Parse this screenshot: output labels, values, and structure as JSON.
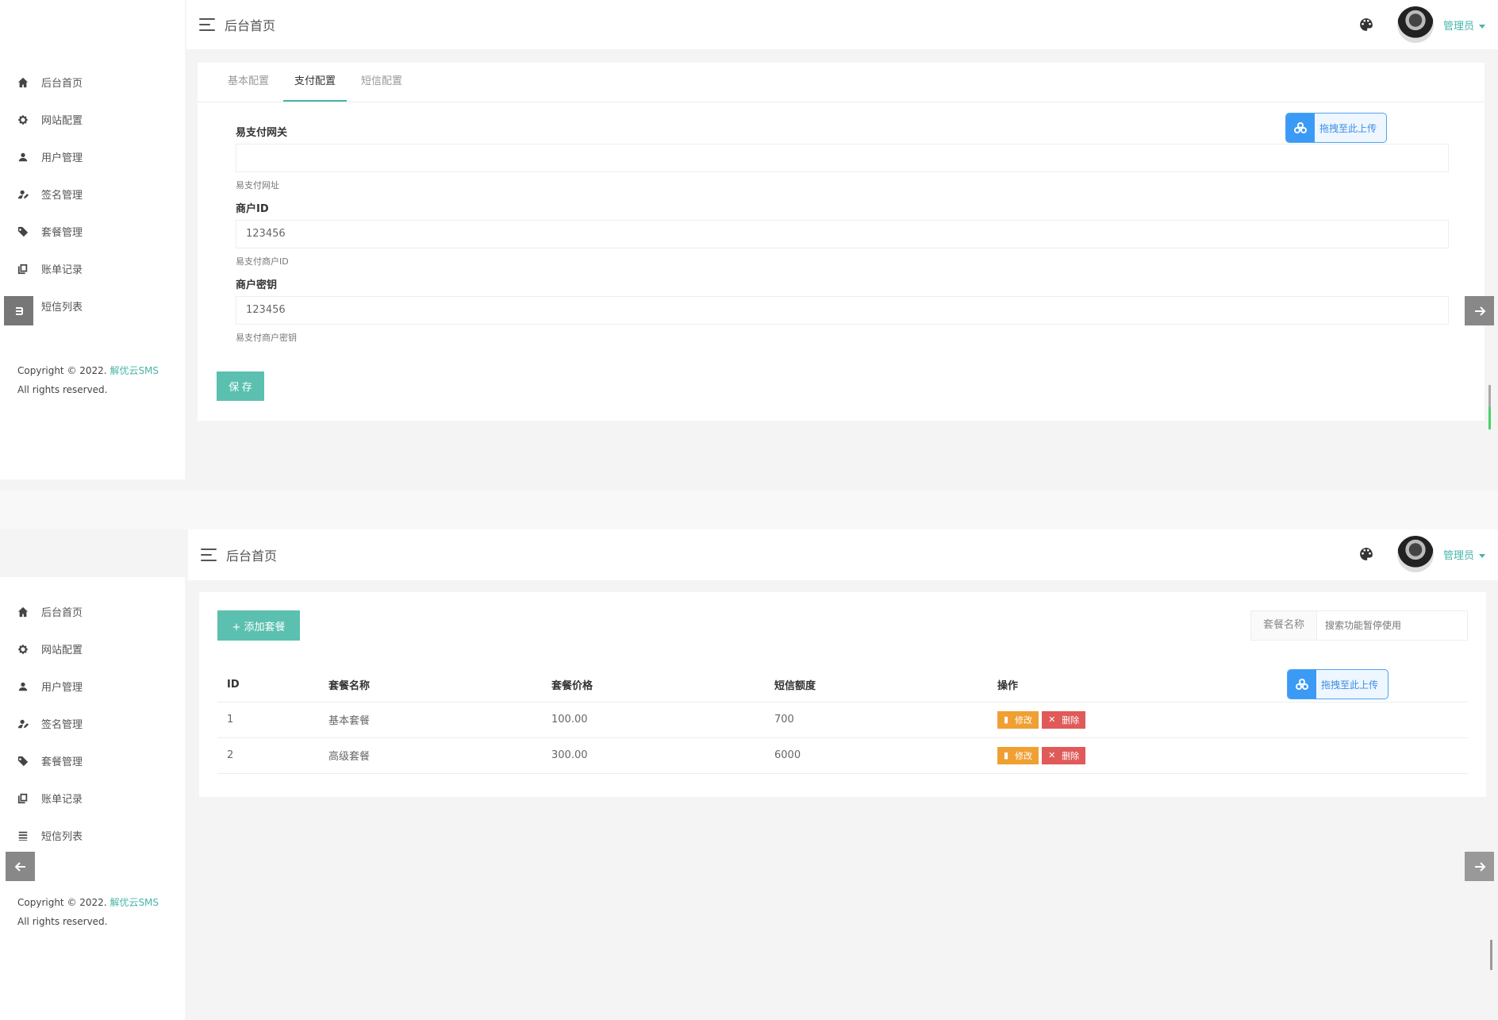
{
  "sidebar": {
    "items": [
      {
        "label": "后台首页",
        "icon": "home-icon"
      },
      {
        "label": "网站配置",
        "icon": "gear-icon"
      },
      {
        "label": "用户管理",
        "icon": "user-icon"
      },
      {
        "label": "签名管理",
        "icon": "signature-icon"
      },
      {
        "label": "套餐管理",
        "icon": "tag-icon"
      },
      {
        "label": "账单记录",
        "icon": "copy-icon"
      },
      {
        "label": "短信列表",
        "icon": "list-icon"
      }
    ],
    "copyright_prefix": "Copyright © 2022. ",
    "copyright_brand": "解优云SMS",
    "copyright_suffix": "All rights reserved."
  },
  "header": {
    "breadcrumb": "后台首页",
    "user_name": "管理员"
  },
  "settings": {
    "tabs": [
      "基本配置",
      "支付配置",
      "短信配置"
    ],
    "active_tab": 1,
    "fields": [
      {
        "label": "易支付网关",
        "value": "",
        "hint": "易支付网址"
      },
      {
        "label": "商户ID",
        "value": "123456",
        "hint": "易支付商户ID"
      },
      {
        "label": "商户密钥",
        "value": "123456",
        "hint": "易支付商户密钥"
      }
    ],
    "save_label": "保 存"
  },
  "upload": {
    "label": "拖拽至此上传"
  },
  "packages": {
    "add_label": "+ 添加套餐",
    "search_label": "套餐名称",
    "search_placeholder": "搜索功能暂停使用",
    "columns": [
      "ID",
      "套餐名称",
      "套餐价格",
      "短信额度",
      "操作"
    ],
    "rows": [
      {
        "id": "1",
        "name": "基本套餐",
        "price": "100.00",
        "quota": "700"
      },
      {
        "id": "2",
        "name": "高级套餐",
        "price": "300.00",
        "quota": "6000"
      }
    ],
    "edit_label": "修改",
    "delete_label": "删除"
  },
  "colors": {
    "accent": "#45b6a8",
    "upload": "#3b9af5",
    "edit": "#f0a033",
    "delete": "#e05a5a"
  }
}
